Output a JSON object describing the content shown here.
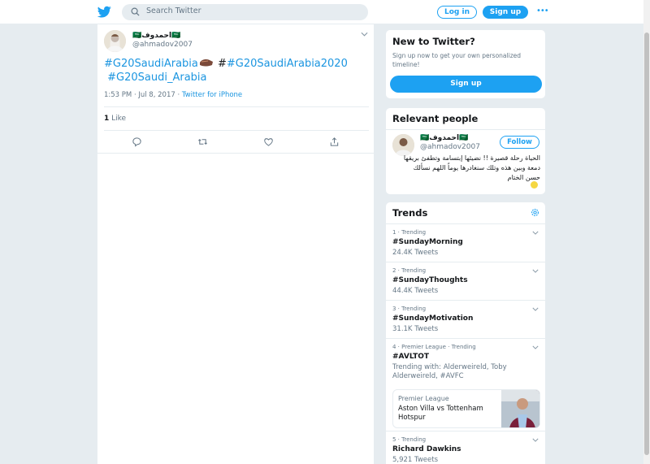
{
  "header": {
    "search_placeholder": "Search Twitter",
    "login_label": "Log in",
    "signup_label": "Sign up",
    "more_label": "•••"
  },
  "tweet": {
    "author_name": "🇸🇦احمدوف🇸🇦",
    "author_handle": "@ahmadov2007",
    "hashtag1": "#G20SaudiArabia",
    "separator": " #",
    "hashtag2": "#G20SaudiArabia2020",
    "hashtag3": "#G20Saudi_Arabia",
    "timestamp": "1:53 PM · Jul 8, 2017 · ",
    "source": "Twitter for iPhone",
    "like_count": "1",
    "like_label": " Like"
  },
  "sidebar": {
    "new_to_twitter": {
      "title": "New to Twitter?",
      "description": "Sign up now to get your own personalized timeline!",
      "signup_label": "Sign up"
    },
    "relevant_people": {
      "title": "Relevant people",
      "name": "🇸🇦احمدوف🇸🇦",
      "handle": "@ahmadov2007",
      "follow_label": "Follow",
      "bio": "الحياة رحلة قصيرة !! نضيئها إبتسامة وتطفئ بريقها دمعة وبين هذه وتلك سنغادرها يوماً اللهم نسألك حسن الختام"
    },
    "trends": {
      "title": "Trends",
      "items": [
        {
          "context": "1 · Trending",
          "name": "#SundayMorning",
          "count": "24.4K Tweets"
        },
        {
          "context": "2 · Trending",
          "name": "#SundayThoughts",
          "count": "44.4K Tweets"
        },
        {
          "context": "3 · Trending",
          "name": "#SundayMotivation",
          "count": "31.1K Tweets"
        },
        {
          "context": "4 · Premier League · Trending",
          "name": "#AVLTOT",
          "with": "Trending with: Alderweireld, Toby Alderweireld, #AVFC",
          "news": {
            "source": "Premier League",
            "headline": "Aston Villa vs Tottenham Hotspur"
          }
        },
        {
          "context": "5 · Trending",
          "name": "Richard Dawkins",
          "count": "5,921 Tweets"
        }
      ]
    }
  },
  "colors": {
    "accent": "#1da1f2",
    "link": "#1b95e0",
    "background": "#e6ecf0"
  }
}
